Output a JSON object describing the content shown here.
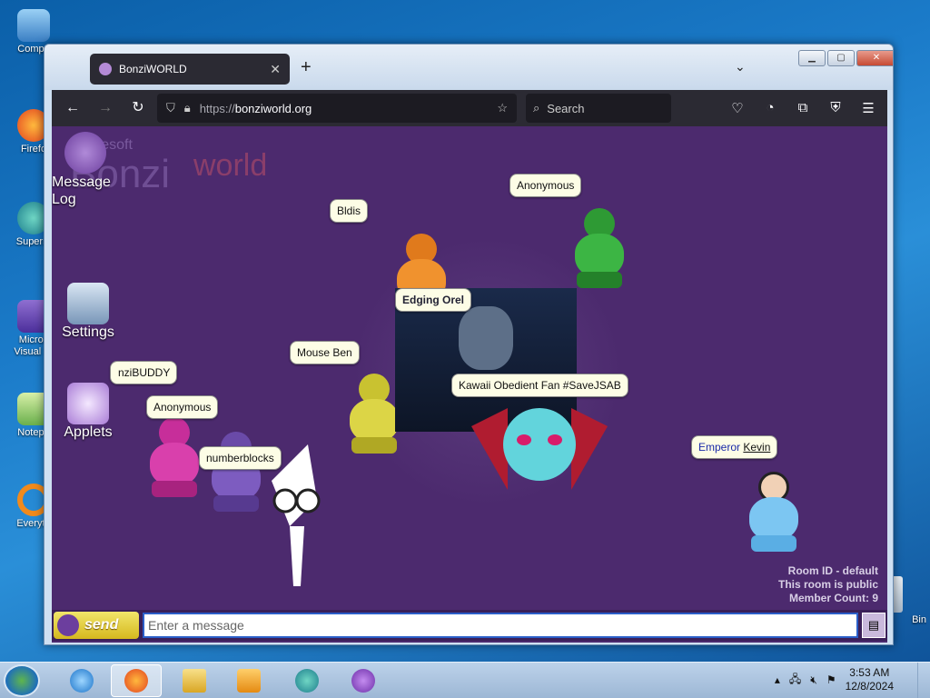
{
  "desktop": {
    "icons": [
      {
        "label": "Compu"
      },
      {
        "label": "Firefo"
      },
      {
        "label": "Superm"
      },
      {
        "label": "Micros Visual St"
      },
      {
        "label": "Notepa"
      },
      {
        "label": "Everyth"
      },
      {
        "label": "Bin"
      }
    ]
  },
  "browser": {
    "tab_title": "BonziWORLD",
    "tab_close": "✕",
    "new_tab": "+",
    "list_tabs": "⌄",
    "url_scheme": "https://",
    "url_host": "bonziworld.org",
    "search_placeholder": "Search",
    "back": "←",
    "forward": "→",
    "reload": "↻",
    "bookmark": "☆",
    "menu": "☰"
  },
  "bonzi": {
    "logo_small": "aresoft",
    "logo_bonzi": "Bonzi",
    "logo_world": "world",
    "sidebar": [
      {
        "label": "Message Log"
      },
      {
        "label": "Settings"
      },
      {
        "label": "Applets"
      }
    ],
    "users": [
      {
        "name": "Bldis"
      },
      {
        "name": "Anonymous"
      },
      {
        "name": "Edging Orel"
      },
      {
        "name": "Mouse Ben"
      },
      {
        "name": "nziBUDDY"
      },
      {
        "name": "Anonymous"
      },
      {
        "name": "Kawaii Obedient Fan #SaveJSAB"
      },
      {
        "name": "numberblocks"
      },
      {
        "name_prefix": "Emperor ",
        "name_link": "Kevin"
      }
    ],
    "room": {
      "id": "Room ID - default",
      "public": "This room is public",
      "members": "Member Count: 9"
    },
    "chat": {
      "send_label": "send",
      "placeholder": "Enter a message"
    }
  },
  "taskbar": {
    "time": "3:53 AM",
    "date": "12/8/2024"
  }
}
